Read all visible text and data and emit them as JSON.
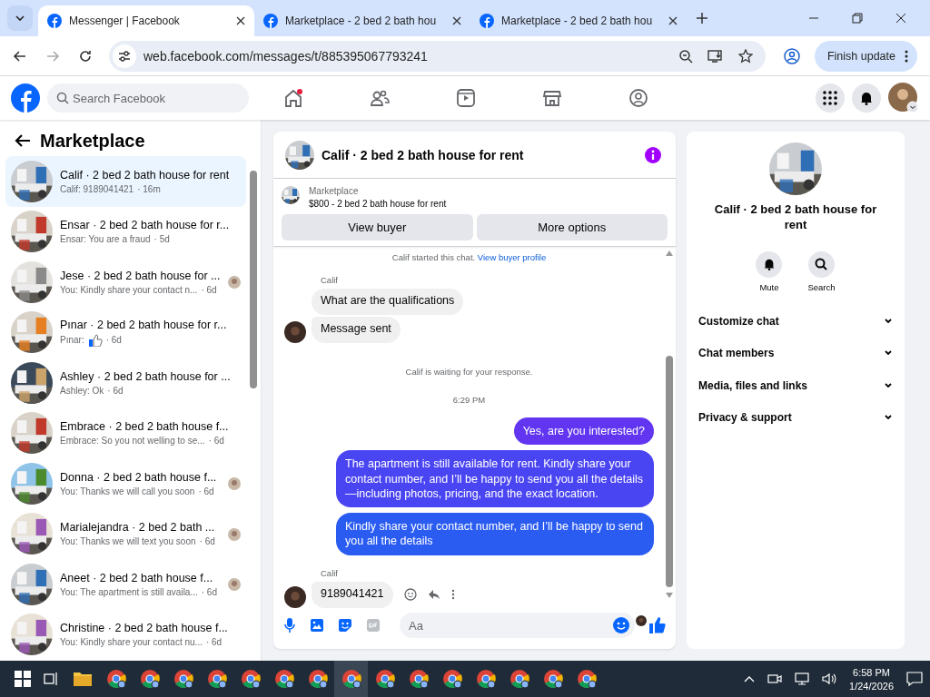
{
  "browser": {
    "tabs": [
      {
        "title": "Messenger | Facebook",
        "selected": true
      },
      {
        "title": "Marketplace - 2 bed 2 bath hou",
        "selected": false
      },
      {
        "title": "Marketplace - 2 bed 2 bath hou",
        "selected": false
      }
    ],
    "url": "web.facebook.com/messages/t/885395067793241",
    "update_button": "Finish update"
  },
  "facebook": {
    "search_placeholder": "Search Facebook",
    "home_notification": true
  },
  "sidebar": {
    "title": "Marketplace",
    "conversations": [
      {
        "name": "Calif · 2 bed 2 bath house for rent",
        "preview": "Calif: 9189041421",
        "kind": "text",
        "time": "· 16m",
        "selected": true,
        "seen": false
      },
      {
        "name": "Ensar · 2 bed 2 bath house for r...",
        "preview": "Ensar: You are a fraud",
        "kind": "text",
        "time": "· 5d",
        "selected": false,
        "seen": false
      },
      {
        "name": "Jese · 2 bed 2 bath house for ...",
        "preview": "You: Kindly share your contact n...",
        "kind": "text",
        "time": "· 6d",
        "selected": false,
        "seen": true
      },
      {
        "name": "Pınar · 2 bed 2 bath house for r...",
        "preview": "Pınar:",
        "kind": "like",
        "time": "· 6d",
        "selected": false,
        "seen": false
      },
      {
        "name": "Ashley · 2 bed 2 bath house for ...",
        "preview": "Ashley: Ok",
        "kind": "text",
        "time": "· 6d",
        "selected": false,
        "seen": false
      },
      {
        "name": "Embrace · 2 bed 2 bath house f...",
        "preview": "Embrace: So you not welling to se...",
        "kind": "text",
        "time": "· 6d",
        "selected": false,
        "seen": false
      },
      {
        "name": "Donna · 2 bed 2 bath house f...",
        "preview": "You: Thanks we will call you soon",
        "kind": "text",
        "time": "· 6d",
        "selected": false,
        "seen": true
      },
      {
        "name": "Marialejandra · 2 bed 2 bath ...",
        "preview": "You: Thanks we will text you soon",
        "kind": "text",
        "time": "· 6d",
        "selected": false,
        "seen": true
      },
      {
        "name": "Aneet · 2 bed 2 bath house f...",
        "preview": "You: The apartment is still availa...",
        "kind": "text",
        "time": "· 6d",
        "selected": false,
        "seen": true
      },
      {
        "name": "Christine · 2 bed 2 bath house f...",
        "preview": "You: Kindly share your contact nu...",
        "kind": "text",
        "time": "· 6d",
        "selected": false,
        "seen": false
      }
    ]
  },
  "chat": {
    "title": "Calif · 2 bed 2 bath house for rent",
    "listing_label": "Marketplace",
    "listing": "$800 - 2 bed 2 bath house for rent",
    "buttons": [
      "View buyer",
      "More options"
    ],
    "messages": [
      {
        "kind": "system",
        "text": "Calif started this chat.",
        "link": "View buyer profile"
      },
      {
        "kind": "sender",
        "text": "Calif"
      },
      {
        "kind": "incoming",
        "text": "What are the qualifications",
        "avatar": false,
        "actions": false
      },
      {
        "kind": "incoming",
        "text": "Message sent",
        "avatar": true,
        "actions": false
      },
      {
        "kind": "system",
        "text": "Calif is waiting for your response."
      },
      {
        "kind": "time",
        "text": "6:29 PM"
      },
      {
        "kind": "outgoing",
        "text": "Yes, are you interested?",
        "color": "#6236f0"
      },
      {
        "kind": "outgoing",
        "text": "The apartment is still available for rent. Kindly share your contact number, and I’ll be happy to send you all the details—including photos, pricing, and the exact location.",
        "color": "#4a45f2"
      },
      {
        "kind": "outgoing",
        "text": "Kindly share your contact number, and I’ll be happy to send you all the details",
        "color": "#2b5cf2"
      },
      {
        "kind": "sender",
        "text": "Calif"
      },
      {
        "kind": "incoming",
        "text": "9189041421",
        "avatar": true,
        "actions": true
      }
    ],
    "seen": true,
    "composer_placeholder": "Aa"
  },
  "details": {
    "title": "Calif · 2 bed 2 bath house for rent",
    "actions": [
      "Mute",
      "Search"
    ],
    "sections": [
      {
        "label": "Customize chat",
        "expanded": false
      },
      {
        "label": "Chat members",
        "expanded": false
      },
      {
        "label": "Media, files and links",
        "expanded": false
      },
      {
        "label": "Privacy & support",
        "expanded": false
      }
    ]
  },
  "taskbar": {
    "time": "6:58 PM",
    "date": "1/24/2026"
  }
}
